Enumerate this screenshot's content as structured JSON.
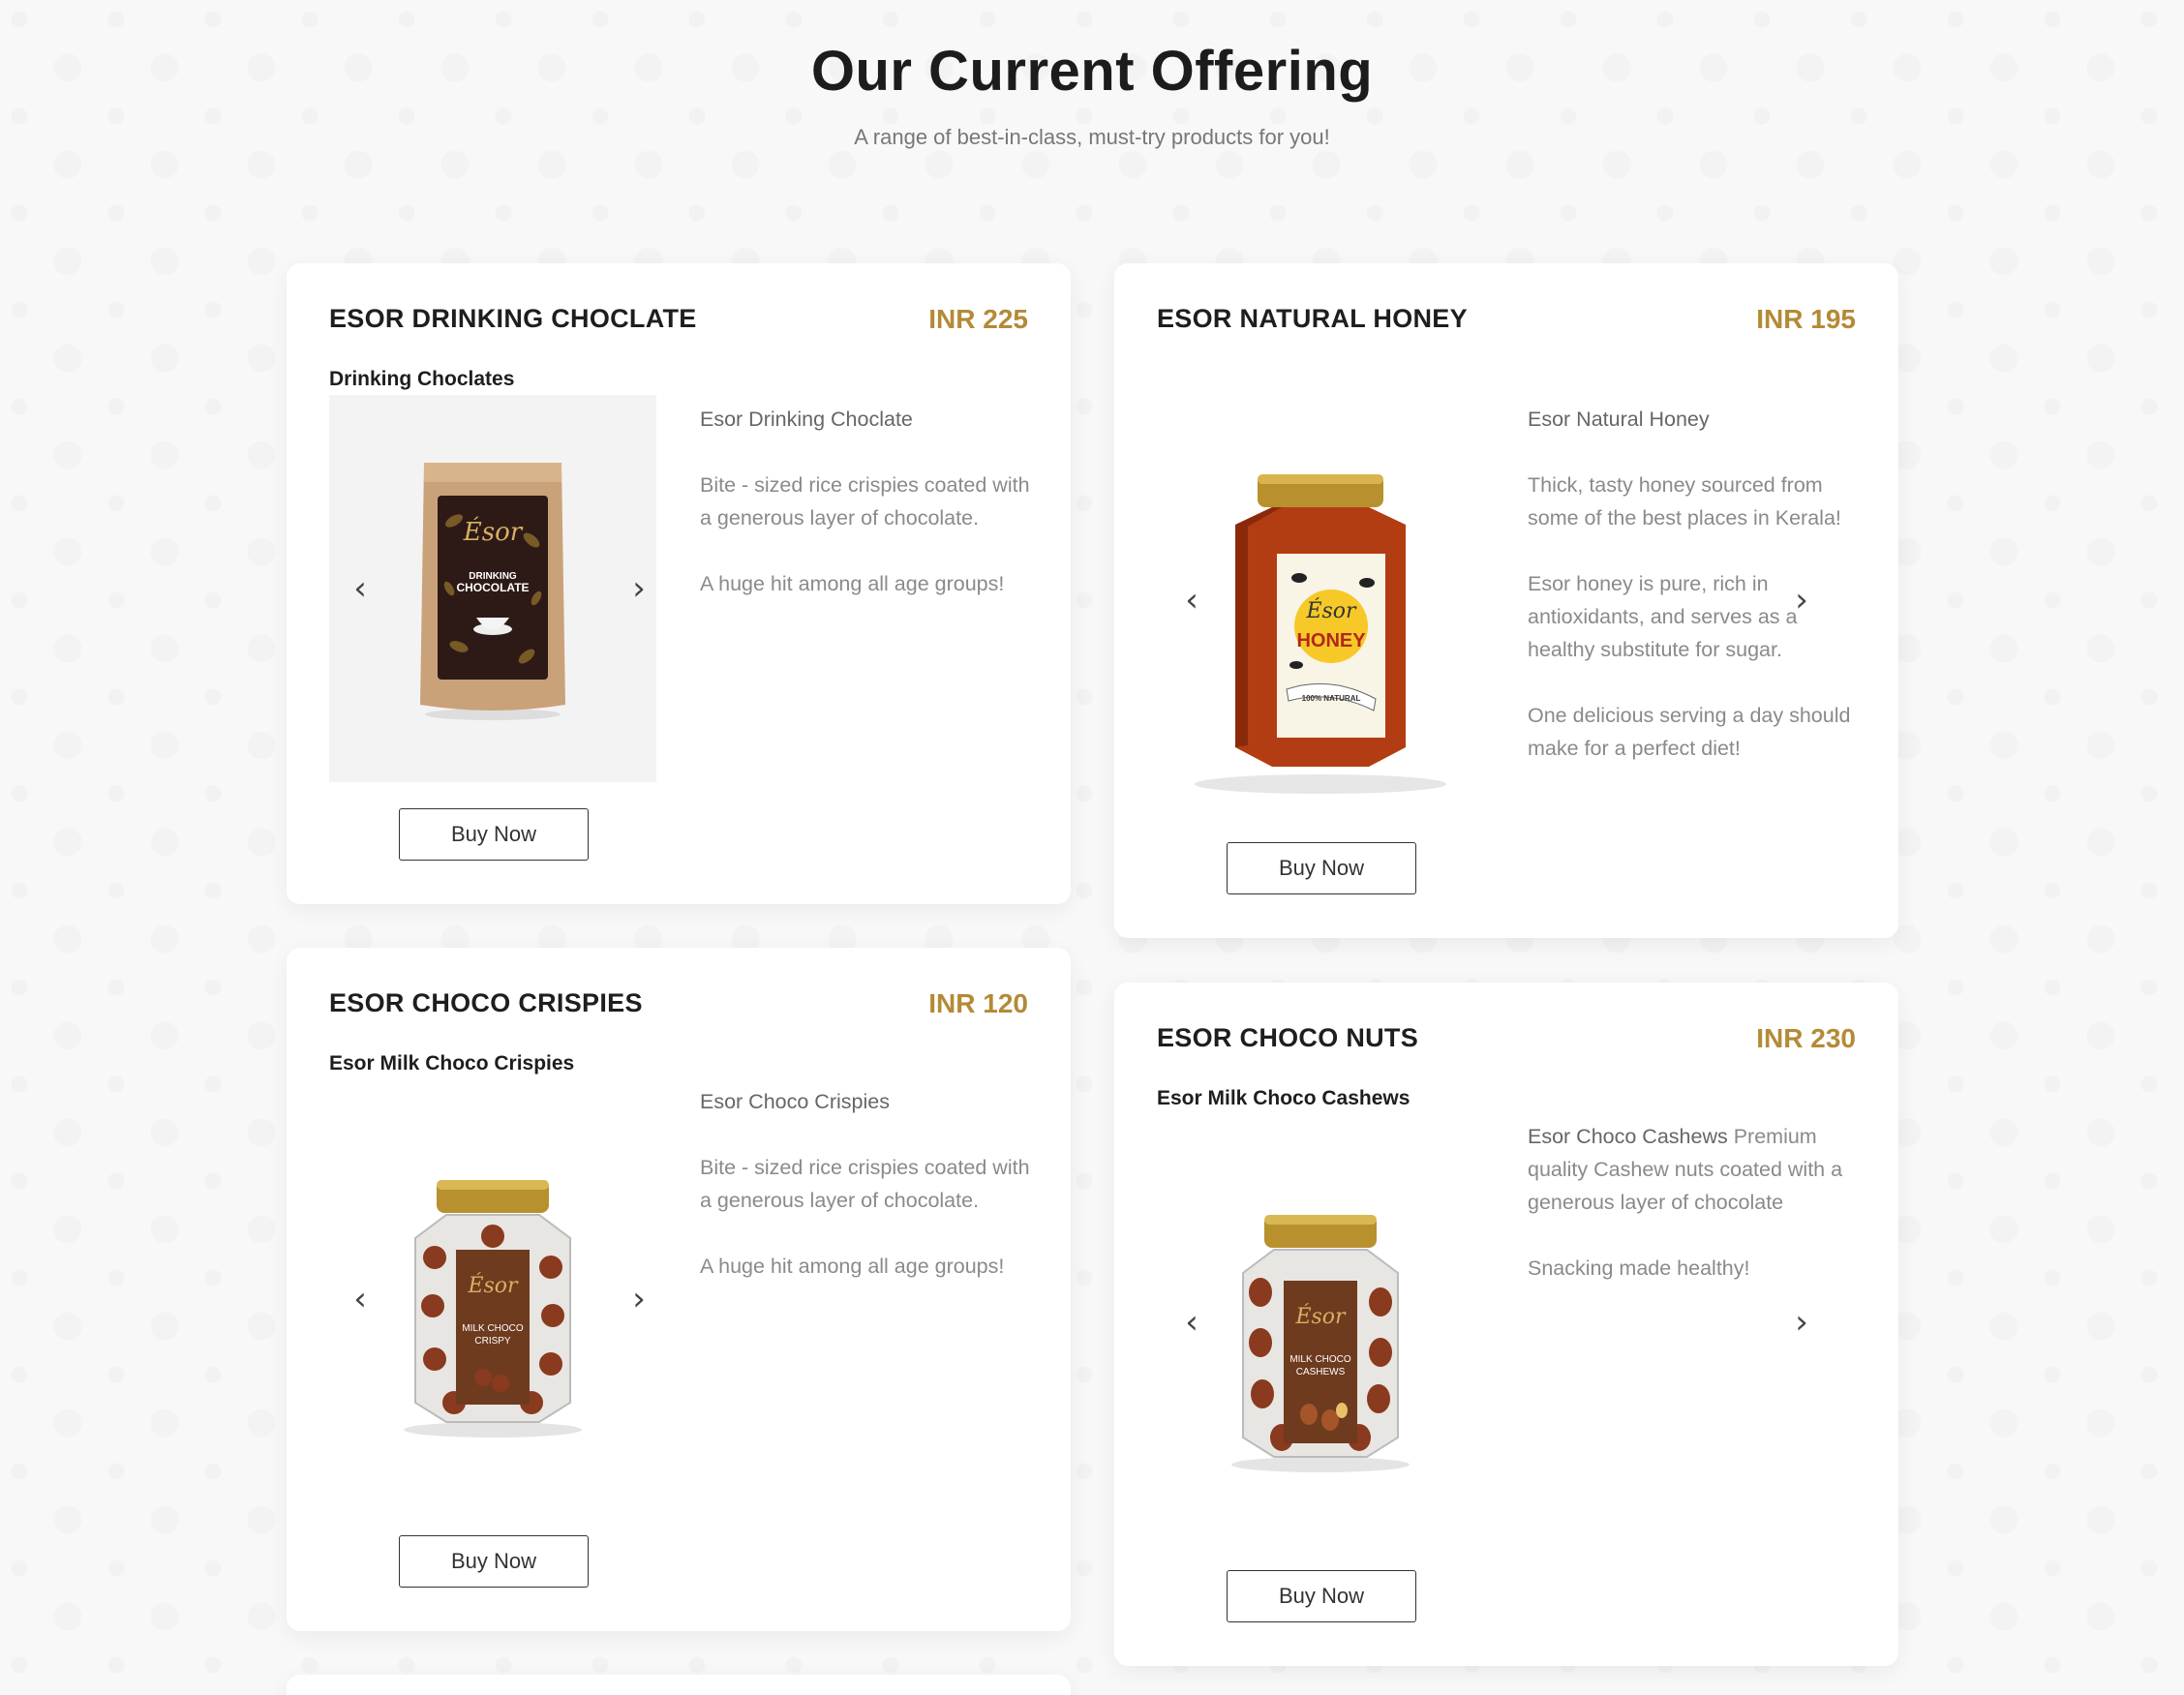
{
  "section": {
    "title": "Our Current Offering",
    "subtitle": "A range of best-in-class, must-try products for you!"
  },
  "products": [
    {
      "name": "ESOR DRINKING CHOCLATE",
      "price": "INR 225",
      "category": "Drinking Choclates",
      "desc_lead": "Esor Drinking Choclate",
      "desc": [
        "Bite - sized rice crispies coated with a generous layer of chocolate.",
        "A huge hit among all age groups!"
      ],
      "buy_label": "Buy Now",
      "image": {
        "brand": "Ésor",
        "label": "DRINKING CHOCOLATE",
        "kind": "pouch"
      }
    },
    {
      "name": "ESOR NATURAL HONEY",
      "price": "INR 195",
      "category": "",
      "desc_lead": "Esor Natural Honey",
      "desc": [
        "Thick, tasty honey sourced from some of the best places in Kerala!",
        "Esor honey is pure, rich in antioxidants, and serves as a healthy substitute for sugar.",
        "One delicious serving a day should make for a perfect diet!"
      ],
      "buy_label": "Buy Now",
      "image": {
        "brand": "Ésor",
        "label": "HONEY",
        "tag": "100% NATURAL",
        "kind": "honey-jar"
      }
    },
    {
      "name": "ESOR CHOCO CRISPIES",
      "price": "INR 120",
      "category": "Esor Milk Choco Crispies",
      "desc_lead": "Esor Choco Crispies",
      "desc": [
        "Bite - sized rice crispies coated with a generous layer of chocolate.",
        "A huge hit among all age groups!"
      ],
      "buy_label": "Buy Now",
      "image": {
        "brand": "Ésor",
        "label": "MILK CHOCO CRISPY",
        "kind": "choco-jar"
      }
    },
    {
      "name": "ESOR CHOCO NUTS",
      "price": "INR 230",
      "category": "Esor Milk Choco Cashews",
      "desc_lead": "Esor Choco Cashews",
      "desc_lead_rest": " Premium quality Cashew nuts coated with a generous layer of chocolate",
      "desc": [
        "Snacking made healthy!"
      ],
      "buy_label": "Buy Now",
      "image": {
        "brand": "Ésor",
        "label": "MILK CHOCO CASHEWS",
        "kind": "choco-jar"
      }
    }
  ],
  "icons": {
    "prev": "chevron-left-icon",
    "next": "chevron-right-icon"
  },
  "colors": {
    "price": "#b38a36",
    "background": "#f9f8f9",
    "card": "#ffffff"
  }
}
